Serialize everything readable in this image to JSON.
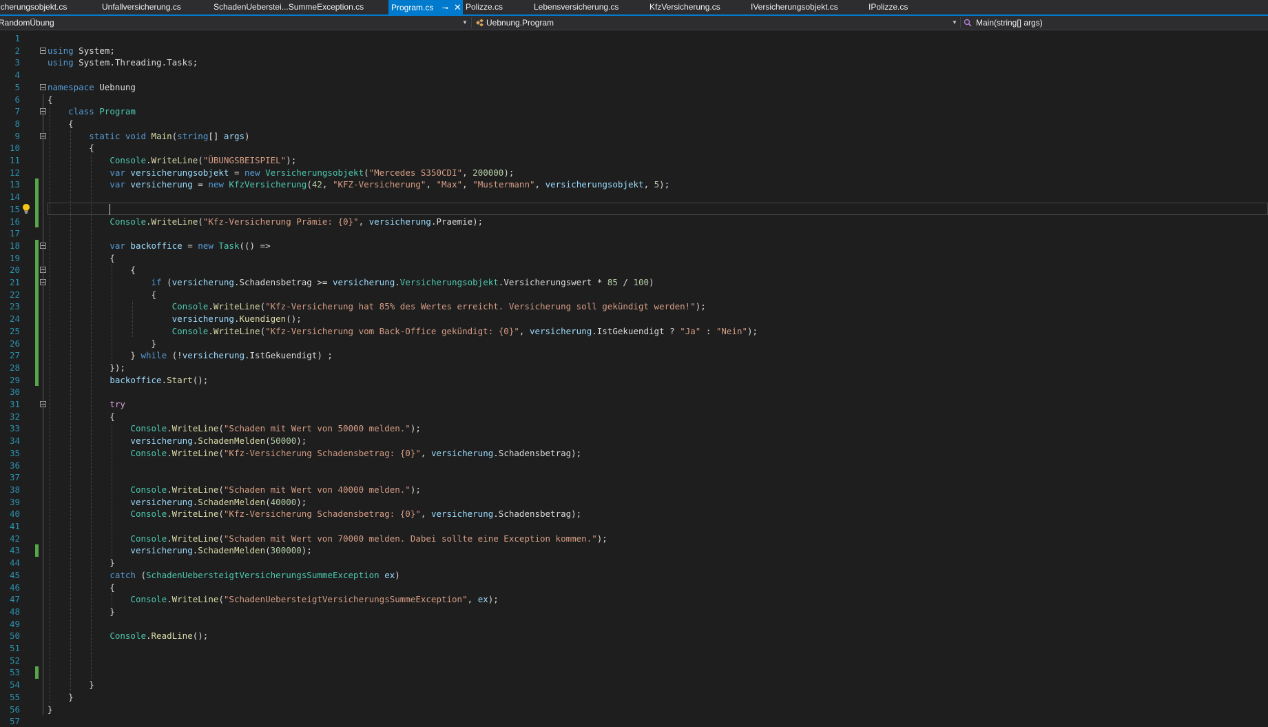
{
  "tabs": [
    {
      "label": "icherungsobjekt.cs",
      "active": false
    },
    {
      "label": "Unfallversicherung.cs",
      "active": false
    },
    {
      "label": "SchadenUeberstei...SummeException.cs",
      "active": false
    },
    {
      "label": "Program.cs",
      "active": true
    },
    {
      "label": "Polizze.cs",
      "active": false
    },
    {
      "label": "Lebensversicherung.cs",
      "active": false
    },
    {
      "label": "KfzVersicherung.cs",
      "active": false
    },
    {
      "label": "IVersicherungsobjekt.cs",
      "active": false
    },
    {
      "label": "IPolizze.cs",
      "active": false
    }
  ],
  "navbar": {
    "project": "RandomÜbung",
    "type": "Uebnung.Program",
    "member": "Main(string[] args)"
  },
  "colors": {
    "accent": "#007acc",
    "background": "#1e1e1e",
    "line_number": "#2b91af",
    "change_marker": "#57a64a"
  },
  "editor": {
    "caret_line": 15,
    "lines": [
      "",
      "using System;",
      "using System.Threading.Tasks;",
      "",
      "namespace Uebnung",
      "{",
      "    class Program",
      "    {",
      "        static void Main(string[] args)",
      "        {",
      "            Console.WriteLine(\"ÜBUNGSBEISPIEL\");",
      "            var versicherungsobjekt = new Versicherungsobjekt(\"Mercedes S350CDI\", 200000);",
      "            var versicherung = new KfzVersicherung(42, \"KFZ-Versicherung\", \"Max\", \"Mustermann\", versicherungsobjekt, 5);",
      "",
      "",
      "            Console.WriteLine(\"Kfz-Versicherung Prämie: {0}\", versicherung.Praemie);",
      "",
      "            var backoffice = new Task(() =>",
      "            {",
      "                {",
      "                    if (versicherung.Schadensbetrag >= versicherung.Versicherungsobjekt.Versicherungswert * 85 / 100)",
      "                    {",
      "                        Console.WriteLine(\"Kfz-Versicherung hat 85% des Wertes erreicht. Versicherung soll gekündigt werden!\");",
      "                        versicherung.Kuendigen();",
      "                        Console.WriteLine(\"Kfz-Versicherung vom Back-Office gekündigt: {0}\", versicherung.IstGekuendigt ? \"Ja\" : \"Nein\");",
      "                    }",
      "                } while (!versicherung.IstGekuendigt) ;",
      "            });",
      "            backoffice.Start();",
      "",
      "            try",
      "            {",
      "                Console.WriteLine(\"Schaden mit Wert von 50000 melden.\");",
      "                versicherung.SchadenMelden(50000);",
      "                Console.WriteLine(\"Kfz-Versicherung Schadensbetrag: {0}\", versicherung.Schadensbetrag);",
      "",
      "",
      "                Console.WriteLine(\"Schaden mit Wert von 40000 melden.\");",
      "                versicherung.SchadenMelden(40000);",
      "                Console.WriteLine(\"Kfz-Versicherung Schadensbetrag: {0}\", versicherung.Schadensbetrag);",
      "",
      "                Console.WriteLine(\"Schaden mit Wert von 70000 melden. Dabei sollte eine Exception kommen.\");",
      "                versicherung.SchadenMelden(300000);",
      "            }",
      "            catch (SchadenUebersteigtVersicherungsSummeException ex)",
      "            {",
      "                Console.WriteLine(\"SchadenUebersteigtVersicherungsSummeException\", ex);",
      "            }",
      "",
      "            Console.ReadLine();",
      "",
      "",
      "",
      "        }",
      "    }",
      "}",
      ""
    ]
  }
}
